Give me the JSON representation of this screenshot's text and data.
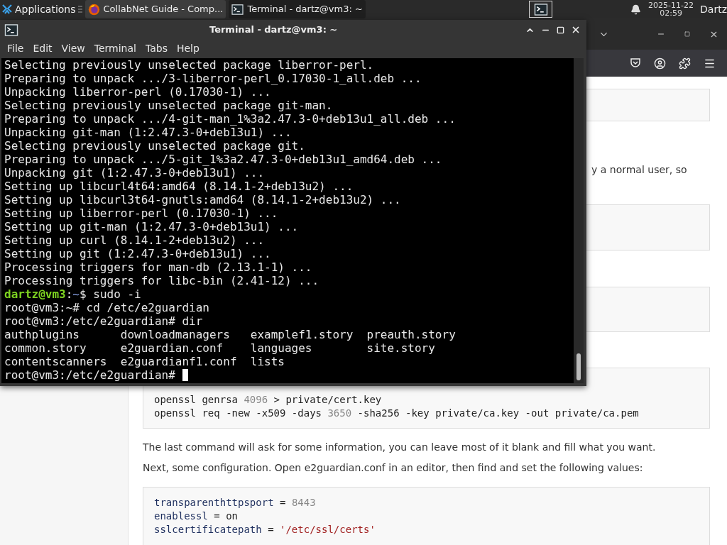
{
  "panel": {
    "app_menu": "Applications",
    "tasks": [
      {
        "kind": "browser",
        "title": "CollabNet Guide - Comp...",
        "selected": false
      },
      {
        "kind": "terminal",
        "title": "Terminal - dartz@vm3: ~",
        "selected": true
      }
    ],
    "clock": {
      "date": "2025-11-22",
      "time": "02:59"
    },
    "user": "Dartz"
  },
  "browser": {
    "content": [
      {
        "kind": "code"
      },
      {
        "kind": "text",
        "text": "y a normal user, so"
      },
      {
        "kind": "code"
      },
      {
        "kind": "code"
      },
      {
        "kind": "code",
        "lines": [
          [
            {
              "kind": "plain",
              "text": "openssl genrsa "
            },
            {
              "kind": "number",
              "text": "4096"
            },
            {
              "kind": "plain",
              "text": " > private/cert.key"
            }
          ],
          [
            {
              "kind": "plain",
              "text": "openssl req -new -x509 -days "
            },
            {
              "kind": "number",
              "text": "3650"
            },
            {
              "kind": "plain",
              "text": " -sha256 -key private/ca.key -out private/ca.pem"
            }
          ]
        ]
      },
      {
        "kind": "paragraph",
        "text": "The last command will ask for some information, you can leave most of it blank and fill what you want."
      },
      {
        "kind": "paragraph",
        "text": "Next, some configuration. Open e2guardian.conf in an editor, then find and set the following values:"
      },
      {
        "kind": "code",
        "lines": [
          [
            {
              "kind": "key",
              "text": "transparenthttpsport"
            },
            {
              "kind": "plain",
              "text": " = "
            },
            {
              "kind": "number",
              "text": "8443"
            }
          ],
          [
            {
              "kind": "key",
              "text": "enablessl"
            },
            {
              "kind": "plain",
              "text": " = on"
            }
          ],
          [
            {
              "kind": "key",
              "text": "sslcertificatepath"
            },
            {
              "kind": "plain",
              "text": " = "
            },
            {
              "kind": "string",
              "text": "'/etc/ssl/certs'"
            }
          ]
        ]
      }
    ]
  },
  "terminal": {
    "title": "Terminal - dartz@vm3: ~",
    "menu": [
      "File",
      "Edit",
      "View",
      "Terminal",
      "Tabs",
      "Help"
    ],
    "lines": [
      {
        "kind": "output",
        "text": "Selecting previously unselected package liberror-perl."
      },
      {
        "kind": "output",
        "text": "Preparing to unpack .../3-liberror-perl_0.17030-1_all.deb ..."
      },
      {
        "kind": "output",
        "text": "Unpacking liberror-perl (0.17030-1) ..."
      },
      {
        "kind": "output",
        "text": "Selecting previously unselected package git-man."
      },
      {
        "kind": "output",
        "text": "Preparing to unpack .../4-git-man_1%3a2.47.3-0+deb13u1_all.deb ..."
      },
      {
        "kind": "output",
        "text": "Unpacking git-man (1:2.47.3-0+deb13u1) ..."
      },
      {
        "kind": "output",
        "text": "Selecting previously unselected package git."
      },
      {
        "kind": "output",
        "text": "Preparing to unpack .../5-git_1%3a2.47.3-0+deb13u1_amd64.deb ..."
      },
      {
        "kind": "output",
        "text": "Unpacking git (1:2.47.3-0+deb13u1) ..."
      },
      {
        "kind": "output",
        "text": "Setting up libcurl4t64:amd64 (8.14.1-2+deb13u2) ..."
      },
      {
        "kind": "output",
        "text": "Setting up libcurl3t64-gnutls:amd64 (8.14.1-2+deb13u2) ..."
      },
      {
        "kind": "output",
        "text": "Setting up liberror-perl (0.17030-1) ..."
      },
      {
        "kind": "output",
        "text": "Setting up git-man (1:2.47.3-0+deb13u1) ..."
      },
      {
        "kind": "output",
        "text": "Setting up curl (8.14.1-2+deb13u2) ..."
      },
      {
        "kind": "output",
        "text": "Setting up git (1:2.47.3-0+deb13u1) ..."
      },
      {
        "kind": "output",
        "text": "Processing triggers for man-db (2.13.1-1) ..."
      },
      {
        "kind": "output",
        "text": "Processing triggers for libc-bin (2.41-12) ..."
      },
      {
        "kind": "prompt",
        "user": "dartz@vm3",
        "separator": ":",
        "path": "~",
        "rest": "$ sudo -i"
      },
      {
        "kind": "output",
        "text": "root@vm3:~# cd /etc/e2guardian"
      },
      {
        "kind": "output",
        "text": "root@vm3:/etc/e2guardian# dir"
      },
      {
        "kind": "output",
        "text": "authplugins      downloadmanagers   examplef1.story  preauth.story"
      },
      {
        "kind": "output",
        "text": "common.story     e2guardian.conf    languages        site.story"
      },
      {
        "kind": "output",
        "text": "contentscanners  e2guardianf1.conf  lists"
      },
      {
        "kind": "input",
        "text": "root@vm3:/etc/e2guardian#",
        "cursor": true
      }
    ]
  }
}
